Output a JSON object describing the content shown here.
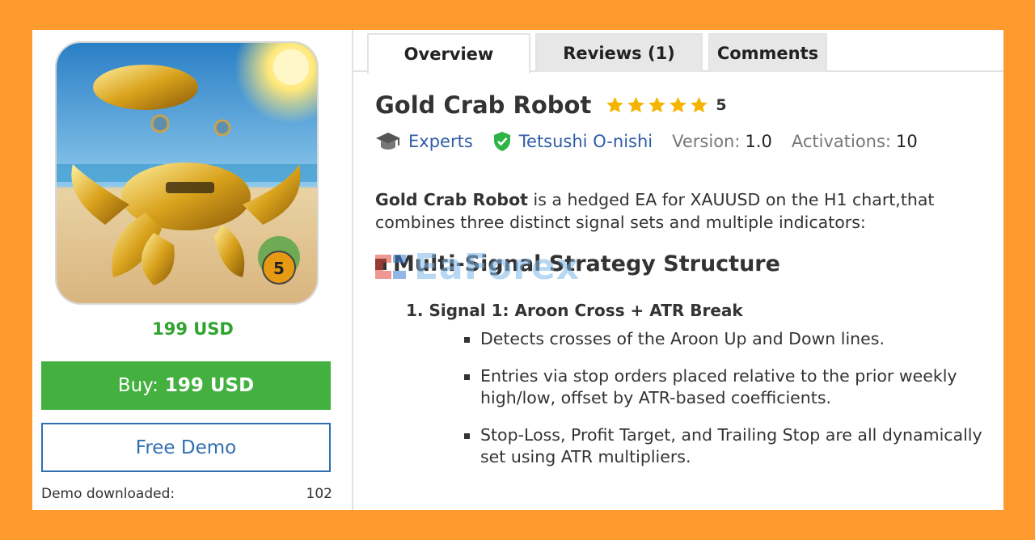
{
  "product": {
    "title": "Gold Crab Robot",
    "rating_value": "5",
    "stars": 5,
    "price": "199 USD",
    "badge_number": "5"
  },
  "buy": {
    "label": "Buy:",
    "amount": "199 USD"
  },
  "demo": {
    "label": "Free Demo",
    "downloaded_label": "Demo downloaded:",
    "downloaded_count": "102"
  },
  "tabs": [
    {
      "label": "Overview",
      "active": true
    },
    {
      "label": "Reviews (1)",
      "active": false
    },
    {
      "label": "Comments",
      "active": false
    }
  ],
  "meta": {
    "category": "Experts",
    "author": "Tetsushi O-nishi",
    "version_label": "Version:",
    "version_value": "1.0",
    "activations_label": "Activations:",
    "activations_value": "10"
  },
  "description": {
    "lead_bold": "Gold Crab Robot",
    "lead_rest": " is a hedged EA for XAUUSD on the H1 chart,that combines three distinct signal sets and multiple indicators:"
  },
  "section": {
    "heading": "Multi-Signal Strategy Structure"
  },
  "watermark": {
    "text": "EaForex"
  },
  "signal": {
    "title": "1. Signal 1: Aroon Cross + ATR Break",
    "bullets": [
      "Detects crosses of the Aroon Up and Down lines.",
      "Entries via stop orders placed relative to the prior weekly high/low, offset by ATR-based coefficients.",
      "Stop-Loss, Profit Target, and Trailing Stop are all dynamically set using ATR multipliers."
    ]
  },
  "colors": {
    "background": "#ff9a2e",
    "buy_green": "#44b040",
    "price_green": "#2fa32f",
    "link_blue": "#2f5da8",
    "star_gold": "#f5b400",
    "verified_green": "#2fb344"
  },
  "icons": [
    "graduation-cap-icon",
    "verified-shield-icon",
    "star-icon",
    "square-bullet-icon"
  ]
}
